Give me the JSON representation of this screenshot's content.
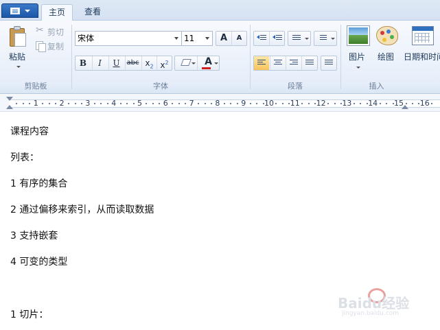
{
  "tabs": {
    "home": "主页",
    "view": "查看"
  },
  "clipboard": {
    "paste": "粘贴",
    "cut": "剪切",
    "copy": "复制",
    "group_label": "剪贴板"
  },
  "font": {
    "font_name": "宋体",
    "font_size": "11",
    "grow": "A",
    "shrink": "A",
    "bold": "B",
    "italic": "I",
    "underline": "U",
    "strike": "abc",
    "sub_base": "x",
    "sub_mark": "2",
    "sup_base": "x",
    "sup_mark": "2",
    "color_letter": "A",
    "group_label": "字体"
  },
  "paragraph": {
    "group_label": "段落"
  },
  "insert": {
    "picture": "图片",
    "paint": "绘图",
    "datetime": "日期和时间",
    "group_label": "插入"
  },
  "ruler": {
    "labels": [
      "1",
      "2",
      "3",
      "4",
      "5",
      "6",
      "7",
      "8",
      "9",
      "10",
      "11",
      "12",
      "13",
      "14",
      "15",
      "16"
    ]
  },
  "document": {
    "lines": [
      "课程内容",
      "列表：",
      "1 有序的集合",
      "2 通过偏移来索引，从而读取数据",
      "3 支持嵌套",
      "4 可变的类型",
      "1 切片："
    ]
  },
  "watermark": {
    "text": "Baidu经验",
    "sub": "jingyan.baidu.com"
  },
  "colors": {
    "accent": "#1c56a8",
    "ribbon": "#e6eef9",
    "highlight": "#f9c35c",
    "font_color_bar": "#d12020"
  }
}
